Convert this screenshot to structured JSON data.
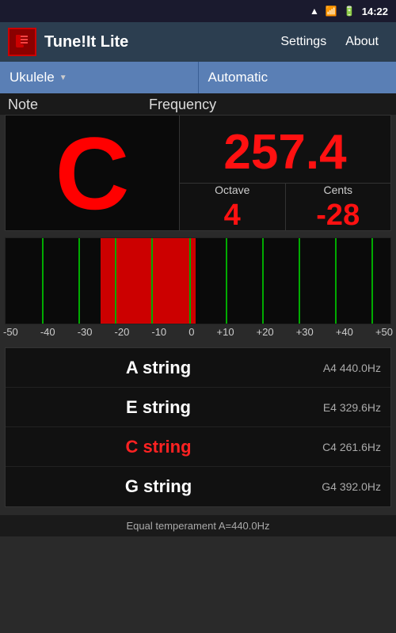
{
  "statusBar": {
    "time": "14:22",
    "icons": [
      "wifi",
      "signal",
      "battery"
    ]
  },
  "titleBar": {
    "appName": "Tune!It Lite",
    "settingsLabel": "Settings",
    "aboutLabel": "About"
  },
  "instrumentBar": {
    "instrument": "Ukulele",
    "mode": "Automatic"
  },
  "noteSection": {
    "noteLabel": "Note",
    "frequencyLabel": "Frequency",
    "note": "C",
    "frequency": "257.4",
    "octaveLabel": "Octave",
    "centsLabel": "Cents",
    "octave": "4",
    "cents": "-28"
  },
  "meterScale": {
    "marks": [
      "-50",
      "-40",
      "-30",
      "-20",
      "-10",
      "0",
      "+10",
      "+20",
      "+30",
      "+40",
      "+50"
    ]
  },
  "strings": [
    {
      "name": "A string",
      "note": "A4",
      "freq": "440.0Hz",
      "active": false
    },
    {
      "name": "E string",
      "note": "E4",
      "freq": "329.6Hz",
      "active": false
    },
    {
      "name": "C string",
      "note": "C4",
      "freq": "261.6Hz",
      "active": true
    },
    {
      "name": "G string",
      "note": "G4",
      "freq": "392.0Hz",
      "active": false
    }
  ],
  "footer": {
    "text": "Equal temperament  A=440.0Hz"
  }
}
